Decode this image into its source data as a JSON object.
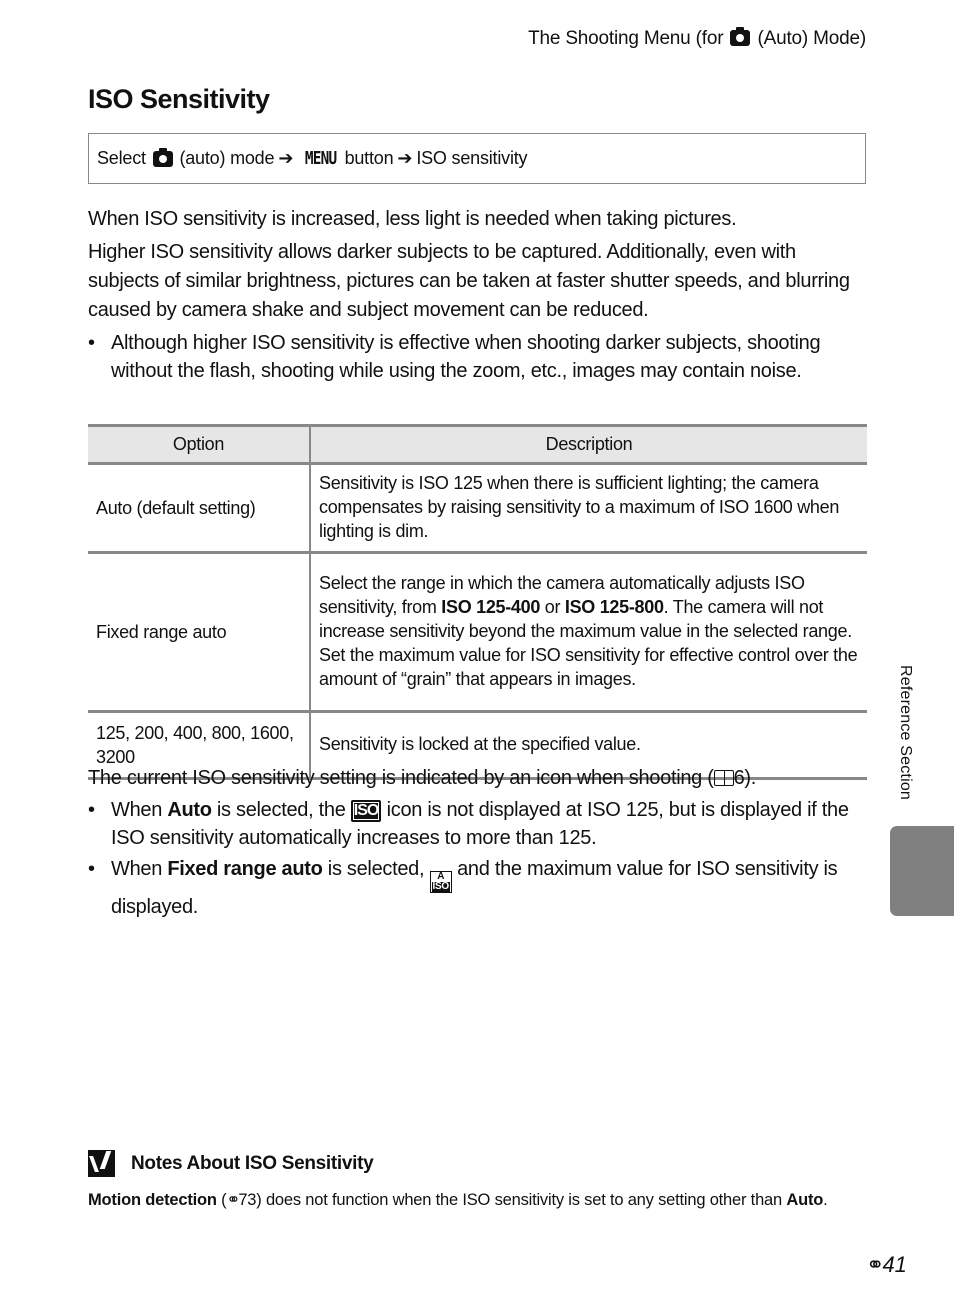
{
  "header": {
    "running_head_before": "The Shooting Menu (for",
    "running_head_after": "(Auto) Mode)",
    "icon": "camera-auto-icon"
  },
  "page_title": "ISO Sensitivity",
  "menu_path": {
    "select": "Select",
    "auto_mode": "(auto) mode",
    "arrow": "➔",
    "menu_glyph": "MENU",
    "button": "button",
    "item": "ISO sensitivity"
  },
  "intro": {
    "p1": "When ISO sensitivity is increased, less light is needed when taking pictures.",
    "p2": "Higher ISO sensitivity allows darker subjects to be captured. Additionally, even with subjects of similar brightness, pictures can be taken at faster shutter speeds, and blurring caused by camera shake and subject movement can be reduced.",
    "bullet1": "Although higher ISO sensitivity is effective when shooting darker subjects, shooting without the flash, shooting while using the zoom, etc., images may contain noise."
  },
  "table": {
    "headers": [
      "Option",
      "Description"
    ],
    "rows": [
      {
        "option": "Auto (default setting)",
        "description": "Sensitivity is ISO 125 when there is sufficient lighting; the camera compensates by raising sensitivity to a maximum of ISO 1600 when lighting is dim."
      },
      {
        "option": "Fixed range auto",
        "desc_a": "Select the range in which the camera automatically adjusts ISO sensitivity, from ",
        "bold_1": "ISO 125-400",
        "desc_or": " or ",
        "bold_2": "ISO 125-800",
        "desc_b": ". The camera will not increase sensitivity beyond the maximum value in the selected range. Set the maximum value for ISO sensitivity for effective control over the amount of “grain” that appears in images."
      },
      {
        "option": "125, 200, 400, 800, 1600, 3200",
        "description": "Sensitivity is locked at the specified value."
      }
    ]
  },
  "after_table": {
    "p3_before": "The current ISO sensitivity setting is indicated by an icon when shooting (",
    "p3_ref_icon": "📖",
    "p3_ref": "6).",
    "bullet_auto": {
      "lead": "When ",
      "bold": "Auto",
      "mid": " is selected, the ",
      "icon_text": "ISO",
      "tail": " icon is not displayed at ISO 125, but is displayed if the ISO sensitivity automatically increases to more than 125."
    },
    "bullet_fixed": {
      "lead": "When ",
      "bold": "Fixed range auto",
      "mid": " is selected, ",
      "icon_top": "A",
      "icon_bottom": "ISO",
      "tail": " and the maximum value for ISO sensitivity is displayed."
    }
  },
  "side_tab": {
    "label": "Reference Section",
    "color": "#808080"
  },
  "notes": {
    "title": "Notes About ISO Sensitivity",
    "bold_lead": "Motion detection",
    "ref_open": " (",
    "ref_icon": "⚭",
    "ref_num": "73)",
    "text": " does not function when the ISO sensitivity is set to any setting other than ",
    "bold_end": "Auto",
    "period": "."
  },
  "page_number": {
    "icon": "⚭",
    "num": "41"
  }
}
